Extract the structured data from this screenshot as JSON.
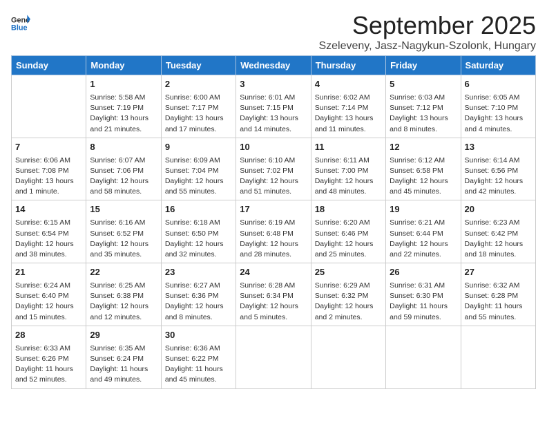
{
  "header": {
    "logo_general": "General",
    "logo_blue": "Blue",
    "title": "September 2025",
    "subtitle": "Szeleveny, Jasz-Nagykun-Szolonk, Hungary"
  },
  "days_of_week": [
    "Sunday",
    "Monday",
    "Tuesday",
    "Wednesday",
    "Thursday",
    "Friday",
    "Saturday"
  ],
  "weeks": [
    [
      {
        "day": "",
        "sunrise": "",
        "sunset": "",
        "daylight": ""
      },
      {
        "day": "1",
        "sunrise": "Sunrise: 5:58 AM",
        "sunset": "Sunset: 7:19 PM",
        "daylight": "Daylight: 13 hours and 21 minutes."
      },
      {
        "day": "2",
        "sunrise": "Sunrise: 6:00 AM",
        "sunset": "Sunset: 7:17 PM",
        "daylight": "Daylight: 13 hours and 17 minutes."
      },
      {
        "day": "3",
        "sunrise": "Sunrise: 6:01 AM",
        "sunset": "Sunset: 7:15 PM",
        "daylight": "Daylight: 13 hours and 14 minutes."
      },
      {
        "day": "4",
        "sunrise": "Sunrise: 6:02 AM",
        "sunset": "Sunset: 7:14 PM",
        "daylight": "Daylight: 13 hours and 11 minutes."
      },
      {
        "day": "5",
        "sunrise": "Sunrise: 6:03 AM",
        "sunset": "Sunset: 7:12 PM",
        "daylight": "Daylight: 13 hours and 8 minutes."
      },
      {
        "day": "6",
        "sunrise": "Sunrise: 6:05 AM",
        "sunset": "Sunset: 7:10 PM",
        "daylight": "Daylight: 13 hours and 4 minutes."
      }
    ],
    [
      {
        "day": "7",
        "sunrise": "Sunrise: 6:06 AM",
        "sunset": "Sunset: 7:08 PM",
        "daylight": "Daylight: 13 hours and 1 minute."
      },
      {
        "day": "8",
        "sunrise": "Sunrise: 6:07 AM",
        "sunset": "Sunset: 7:06 PM",
        "daylight": "Daylight: 12 hours and 58 minutes."
      },
      {
        "day": "9",
        "sunrise": "Sunrise: 6:09 AM",
        "sunset": "Sunset: 7:04 PM",
        "daylight": "Daylight: 12 hours and 55 minutes."
      },
      {
        "day": "10",
        "sunrise": "Sunrise: 6:10 AM",
        "sunset": "Sunset: 7:02 PM",
        "daylight": "Daylight: 12 hours and 51 minutes."
      },
      {
        "day": "11",
        "sunrise": "Sunrise: 6:11 AM",
        "sunset": "Sunset: 7:00 PM",
        "daylight": "Daylight: 12 hours and 48 minutes."
      },
      {
        "day": "12",
        "sunrise": "Sunrise: 6:12 AM",
        "sunset": "Sunset: 6:58 PM",
        "daylight": "Daylight: 12 hours and 45 minutes."
      },
      {
        "day": "13",
        "sunrise": "Sunrise: 6:14 AM",
        "sunset": "Sunset: 6:56 PM",
        "daylight": "Daylight: 12 hours and 42 minutes."
      }
    ],
    [
      {
        "day": "14",
        "sunrise": "Sunrise: 6:15 AM",
        "sunset": "Sunset: 6:54 PM",
        "daylight": "Daylight: 12 hours and 38 minutes."
      },
      {
        "day": "15",
        "sunrise": "Sunrise: 6:16 AM",
        "sunset": "Sunset: 6:52 PM",
        "daylight": "Daylight: 12 hours and 35 minutes."
      },
      {
        "day": "16",
        "sunrise": "Sunrise: 6:18 AM",
        "sunset": "Sunset: 6:50 PM",
        "daylight": "Daylight: 12 hours and 32 minutes."
      },
      {
        "day": "17",
        "sunrise": "Sunrise: 6:19 AM",
        "sunset": "Sunset: 6:48 PM",
        "daylight": "Daylight: 12 hours and 28 minutes."
      },
      {
        "day": "18",
        "sunrise": "Sunrise: 6:20 AM",
        "sunset": "Sunset: 6:46 PM",
        "daylight": "Daylight: 12 hours and 25 minutes."
      },
      {
        "day": "19",
        "sunrise": "Sunrise: 6:21 AM",
        "sunset": "Sunset: 6:44 PM",
        "daylight": "Daylight: 12 hours and 22 minutes."
      },
      {
        "day": "20",
        "sunrise": "Sunrise: 6:23 AM",
        "sunset": "Sunset: 6:42 PM",
        "daylight": "Daylight: 12 hours and 18 minutes."
      }
    ],
    [
      {
        "day": "21",
        "sunrise": "Sunrise: 6:24 AM",
        "sunset": "Sunset: 6:40 PM",
        "daylight": "Daylight: 12 hours and 15 minutes."
      },
      {
        "day": "22",
        "sunrise": "Sunrise: 6:25 AM",
        "sunset": "Sunset: 6:38 PM",
        "daylight": "Daylight: 12 hours and 12 minutes."
      },
      {
        "day": "23",
        "sunrise": "Sunrise: 6:27 AM",
        "sunset": "Sunset: 6:36 PM",
        "daylight": "Daylight: 12 hours and 8 minutes."
      },
      {
        "day": "24",
        "sunrise": "Sunrise: 6:28 AM",
        "sunset": "Sunset: 6:34 PM",
        "daylight": "Daylight: 12 hours and 5 minutes."
      },
      {
        "day": "25",
        "sunrise": "Sunrise: 6:29 AM",
        "sunset": "Sunset: 6:32 PM",
        "daylight": "Daylight: 12 hours and 2 minutes."
      },
      {
        "day": "26",
        "sunrise": "Sunrise: 6:31 AM",
        "sunset": "Sunset: 6:30 PM",
        "daylight": "Daylight: 11 hours and 59 minutes."
      },
      {
        "day": "27",
        "sunrise": "Sunrise: 6:32 AM",
        "sunset": "Sunset: 6:28 PM",
        "daylight": "Daylight: 11 hours and 55 minutes."
      }
    ],
    [
      {
        "day": "28",
        "sunrise": "Sunrise: 6:33 AM",
        "sunset": "Sunset: 6:26 PM",
        "daylight": "Daylight: 11 hours and 52 minutes."
      },
      {
        "day": "29",
        "sunrise": "Sunrise: 6:35 AM",
        "sunset": "Sunset: 6:24 PM",
        "daylight": "Daylight: 11 hours and 49 minutes."
      },
      {
        "day": "30",
        "sunrise": "Sunrise: 6:36 AM",
        "sunset": "Sunset: 6:22 PM",
        "daylight": "Daylight: 11 hours and 45 minutes."
      },
      {
        "day": "",
        "sunrise": "",
        "sunset": "",
        "daylight": ""
      },
      {
        "day": "",
        "sunrise": "",
        "sunset": "",
        "daylight": ""
      },
      {
        "day": "",
        "sunrise": "",
        "sunset": "",
        "daylight": ""
      },
      {
        "day": "",
        "sunrise": "",
        "sunset": "",
        "daylight": ""
      }
    ]
  ]
}
